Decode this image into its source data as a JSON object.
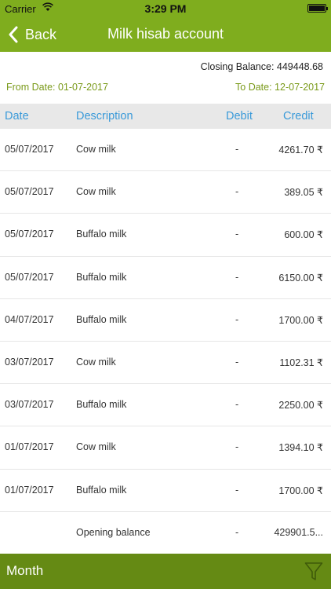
{
  "status_bar": {
    "carrier": "Carrier",
    "time": "3:29 PM"
  },
  "nav": {
    "back_label": "Back",
    "title": "Milk hisab account"
  },
  "summary": {
    "closing_balance": "Closing Balance: 449448.68",
    "from_date": "From Date: 01-07-2017",
    "to_date": "To Date: 12-07-2017"
  },
  "table": {
    "headers": {
      "date": "Date",
      "description": "Description",
      "debit": "Debit",
      "credit": "Credit"
    },
    "rows": [
      {
        "date": "05/07/2017",
        "description": "Cow milk",
        "debit": "-",
        "credit": "4261.70 ₹"
      },
      {
        "date": "05/07/2017",
        "description": "Cow milk",
        "debit": "-",
        "credit": "389.05 ₹"
      },
      {
        "date": "05/07/2017",
        "description": "Buffalo milk",
        "debit": "-",
        "credit": "600.00 ₹"
      },
      {
        "date": "05/07/2017",
        "description": "Buffalo milk",
        "debit": "-",
        "credit": "6150.00 ₹"
      },
      {
        "date": "04/07/2017",
        "description": "Buffalo milk",
        "debit": "-",
        "credit": "1700.00 ₹"
      },
      {
        "date": "03/07/2017",
        "description": "Cow milk",
        "debit": "-",
        "credit": "1102.31 ₹"
      },
      {
        "date": "03/07/2017",
        "description": "Buffalo milk",
        "debit": "-",
        "credit": "2250.00 ₹"
      },
      {
        "date": "01/07/2017",
        "description": "Cow milk",
        "debit": "-",
        "credit": "1394.10 ₹"
      },
      {
        "date": "01/07/2017",
        "description": "Buffalo milk",
        "debit": "-",
        "credit": "1700.00 ₹"
      },
      {
        "date": "",
        "description": "Opening balance",
        "debit": "-",
        "credit": "429901.5..."
      }
    ]
  },
  "bottom_bar": {
    "month_label": "Month",
    "filter_icon": "filter-icon"
  },
  "colors": {
    "nav_green": "#7fad1e",
    "bottom_green": "#658a14",
    "header_blue": "#3a9ad9",
    "date_green": "#7a9a1a"
  }
}
